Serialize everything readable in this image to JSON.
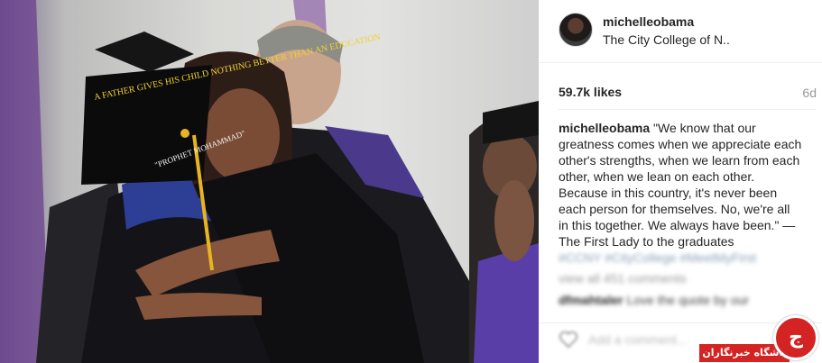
{
  "post": {
    "photo_description": "",
    "cap_text": "A FATHER GIVES HIS CHILD NOTHING BETTER THAN AN EDUCATION",
    "cap_attribution": "\"PROPHET MOHAMMAD\""
  },
  "header": {
    "username": "michelleobama",
    "location": "The City College of N.."
  },
  "stats": {
    "likes": "59.7k likes",
    "age": "6d"
  },
  "caption": {
    "username": "michelleobama",
    "text": "\"We know that our greatness comes when we appreciate each other's strengths, when we learn from each other, when we lean on each other. Because in this country, it's never been each person for themselves. No, we're all in this together. We always have been.\" —The First Lady to the graduates",
    "hashtags": "#CCNY #CityCollege #MeetMyFirst",
    "view_all": "view all 451 comments"
  },
  "comments": [
    {
      "username": "dfmahtaler",
      "text": "Love the quote by our"
    }
  ],
  "add_comment": {
    "placeholder": "Add a comment..."
  },
  "watermark": {
    "site_name": "باشگاه خبرنگاران",
    "logo_glyph": "ج"
  },
  "icons": {
    "like": "heart-icon",
    "site_logo": "logo-icon"
  },
  "colors": {
    "accent": "#d42323",
    "muted": "#999999",
    "text": "#262626"
  }
}
